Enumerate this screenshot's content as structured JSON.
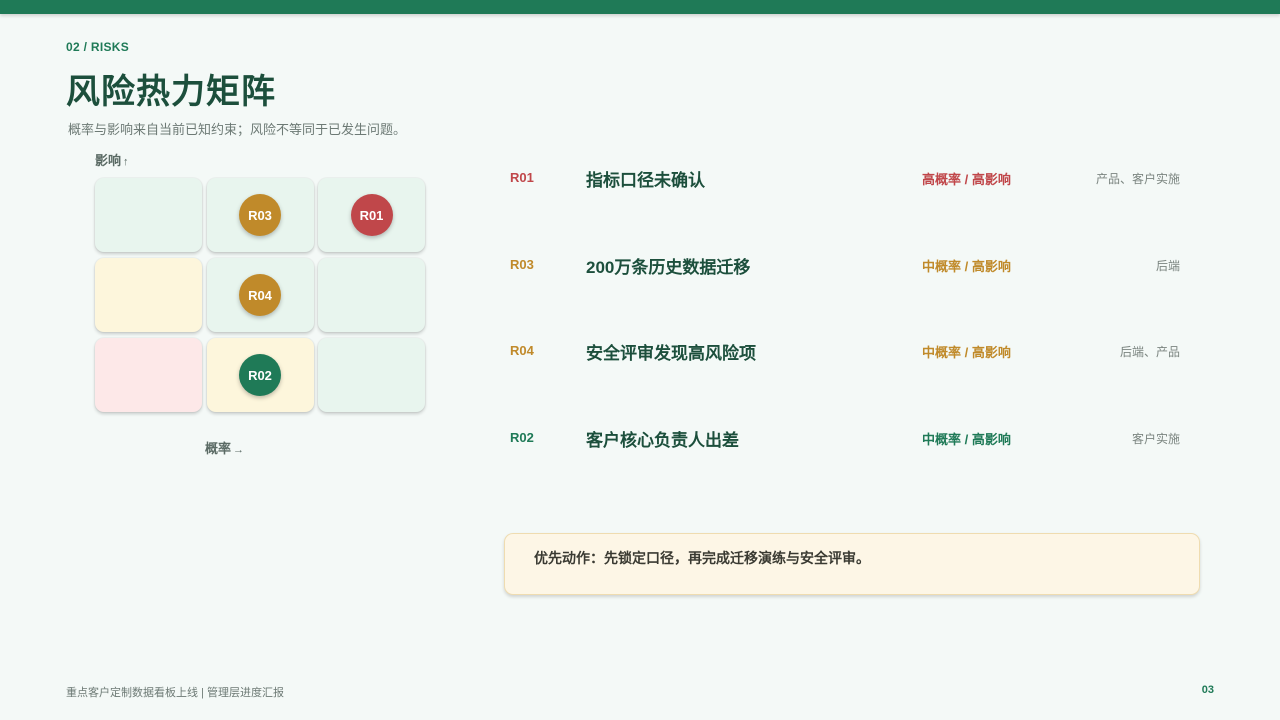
{
  "header": {
    "kicker": "02 / RISKS",
    "title": "风险热力矩阵",
    "subtitle": "概率与影响来自当前已知约束；风险不等同于已发生问题。"
  },
  "matrix": {
    "y_axis_label": "影响",
    "y_axis_arrow": "↑",
    "x_axis_label": "概率",
    "x_axis_arrow": "→",
    "cells": [
      {
        "row": 0,
        "col": 0,
        "tone": "green",
        "badge": ""
      },
      {
        "row": 0,
        "col": 1,
        "tone": "green",
        "badge": "R03",
        "badge_color": "gold"
      },
      {
        "row": 0,
        "col": 2,
        "tone": "green",
        "badge": "R01",
        "badge_color": "red"
      },
      {
        "row": 1,
        "col": 0,
        "tone": "yellow",
        "badge": ""
      },
      {
        "row": 1,
        "col": 1,
        "tone": "green",
        "badge": "R04",
        "badge_color": "gold"
      },
      {
        "row": 1,
        "col": 2,
        "tone": "green",
        "badge": ""
      },
      {
        "row": 2,
        "col": 0,
        "tone": "pink",
        "badge": ""
      },
      {
        "row": 2,
        "col": 1,
        "tone": "yellow",
        "badge": "R02",
        "badge_color": "green"
      },
      {
        "row": 2,
        "col": 2,
        "tone": "green",
        "badge": ""
      }
    ]
  },
  "risks": [
    {
      "id": "R01",
      "name": "指标口径未确认",
      "level": "高概率 / 高影响",
      "owner": "产品、客户实施",
      "color": "red"
    },
    {
      "id": "R03",
      "name": "200万条历史数据迁移",
      "level": "中概率 / 高影响",
      "owner": "后端",
      "color": "gold"
    },
    {
      "id": "R04",
      "name": "安全评审发现高风险项",
      "level": "中概率 / 高影响",
      "owner": "后端、产品",
      "color": "gold"
    },
    {
      "id": "R02",
      "name": "客户核心负责人出差",
      "level": "中概率 / 高影响",
      "owner": "客户实施",
      "color": "green"
    }
  ],
  "action": {
    "text": "优先动作：先锁定口径，再完成迁移演练与安全评审。"
  },
  "footer": {
    "text": "重点客户定制数据看板上线 | 管理层进度汇报",
    "page": "03"
  },
  "colors": {
    "brand": "#1f7a57",
    "red": "#c0474a",
    "gold": "#c08a2a",
    "cell_green": "#e8f5ee",
    "cell_yellow": "#fdf6dc",
    "cell_pink": "#fde8e8"
  }
}
